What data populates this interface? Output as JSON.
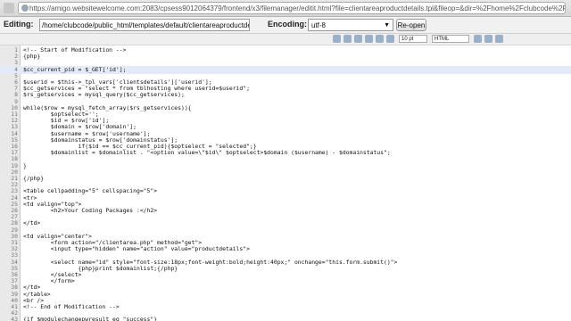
{
  "browser": {
    "url": "https://amigo.websitewelcome.com:2083/cpsess9012064379/frontend/x3/filemanager/editit.html?file=clientareaproductdetails.tpl&fileop=&dir=%2Fhome%2Fclubcode%2Fpublic_html%2Fte"
  },
  "editor_bar": {
    "editing_label": "Editing:",
    "file_path": "/home/clubcode/public_html/templates/default/clientareaproductdetails.tpl",
    "encoding_label": "Encoding:",
    "encoding_value": "utf-8",
    "reopen_label": "Re-open"
  },
  "toolbar": {
    "font_size": "10 pt",
    "syntax": "HTML"
  },
  "code_lines": [
    {
      "n": "1",
      "t": "<!-- Start of Modification -->"
    },
    {
      "n": "2",
      "t": "{php}"
    },
    {
      "n": "3",
      "t": ""
    },
    {
      "n": "4",
      "t": "$cc_current_pid = $_GET['id'];"
    },
    {
      "n": "5",
      "t": ""
    },
    {
      "n": "6",
      "t": "$userid = $this->_tpl_vars['clientsdetails']['userid'];"
    },
    {
      "n": "7",
      "t": "$cc_getservices = \"select * from tblhosting where userid=$userid\";"
    },
    {
      "n": "8",
      "t": "$rs_getservices = mysql_query($cc_getservices);"
    },
    {
      "n": "9",
      "t": ""
    },
    {
      "n": "10",
      "t": "while($row = mysql_fetch_array($rs_getservices)){"
    },
    {
      "n": "11",
      "t": "        $optselect='';"
    },
    {
      "n": "12",
      "t": "        $id = $row['id'];"
    },
    {
      "n": "13",
      "t": "        $domain = $row['domain'];"
    },
    {
      "n": "14",
      "t": "        $username = $row['username'];"
    },
    {
      "n": "15",
      "t": "        $domainstatus = $row['domainstatus'];"
    },
    {
      "n": "16",
      "t": "                if($id == $cc_current_pid){$optselect = \"selected\";}"
    },
    {
      "n": "17",
      "t": "        $domainlist = $domainlist . \"<option value=\\\"$id\\\" $optselect>$domain ($username) - $domainstatus\";"
    },
    {
      "n": "18",
      "t": ""
    },
    {
      "n": "19",
      "t": "}"
    },
    {
      "n": "20",
      "t": ""
    },
    {
      "n": "21",
      "t": "{/php}"
    },
    {
      "n": "22",
      "t": ""
    },
    {
      "n": "23",
      "t": "<table cellpadding=\"5\" cellspacing=\"5\">"
    },
    {
      "n": "24",
      "t": "<tr>"
    },
    {
      "n": "25",
      "t": "<td valign=\"top\">"
    },
    {
      "n": "26",
      "t": "        <h2>Your Coding Packages :</h2>"
    },
    {
      "n": "27",
      "t": ""
    },
    {
      "n": "28",
      "t": "</td>"
    },
    {
      "n": "29",
      "t": ""
    },
    {
      "n": "30",
      "t": "<td valign=\"center\">"
    },
    {
      "n": "31",
      "t": "        <form action=\"/clientarea.php\" method=\"get\">"
    },
    {
      "n": "32",
      "t": "        <input type=\"hidden\" name=\"action\" value=\"productdetails\">"
    },
    {
      "n": "33",
      "t": ""
    },
    {
      "n": "34",
      "t": "        <select name=\"id\" style=\"font-size:18px;font-weight:bold;height:40px;\" onchange=\"this.form.submit()\">"
    },
    {
      "n": "35",
      "t": "                {php}print $domainlist;{/php}"
    },
    {
      "n": "36",
      "t": "        </select>"
    },
    {
      "n": "37",
      "t": "        </form>"
    },
    {
      "n": "38",
      "t": "</td>"
    },
    {
      "n": "39",
      "t": "</table>"
    },
    {
      "n": "40",
      "t": "<br />"
    },
    {
      "n": "41",
      "t": "<!-- End of Modification -->"
    },
    {
      "n": "42",
      "t": ""
    },
    {
      "n": "43",
      "t": "{if $modulechangepwresult eq \"success\"}"
    }
  ]
}
